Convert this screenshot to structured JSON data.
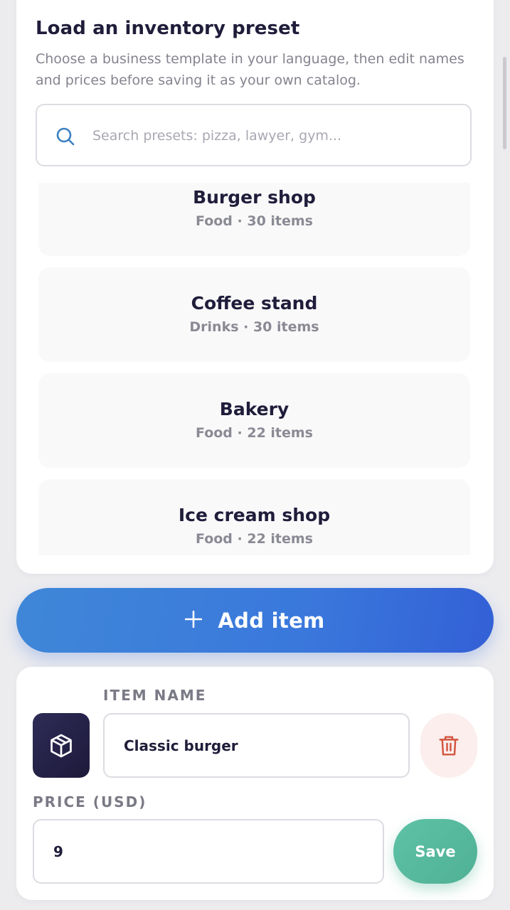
{
  "preset": {
    "title": "Load an inventory preset",
    "description": "Choose a business template in your language, then edit names and prices before saving it as your own catalog.",
    "search_placeholder": "Search presets: pizza, lawyer, gym...",
    "items": [
      {
        "name": "Burger shop",
        "meta": "Food · 30 items"
      },
      {
        "name": "Coffee stand",
        "meta": "Drinks · 30 items"
      },
      {
        "name": "Bakery",
        "meta": "Food · 22 items"
      },
      {
        "name": "Ice cream shop",
        "meta": "Food · 22 items"
      }
    ]
  },
  "add_item": {
    "label": "Add item"
  },
  "item": {
    "name_label": "ITEM NAME",
    "name_value": "Classic burger",
    "price_label": "PRICE (USD)",
    "price_value": "9",
    "save_label": "Save"
  },
  "colors": {
    "accent": "#3a78dc",
    "save": "#55b79b",
    "delete": "#d2553f"
  }
}
